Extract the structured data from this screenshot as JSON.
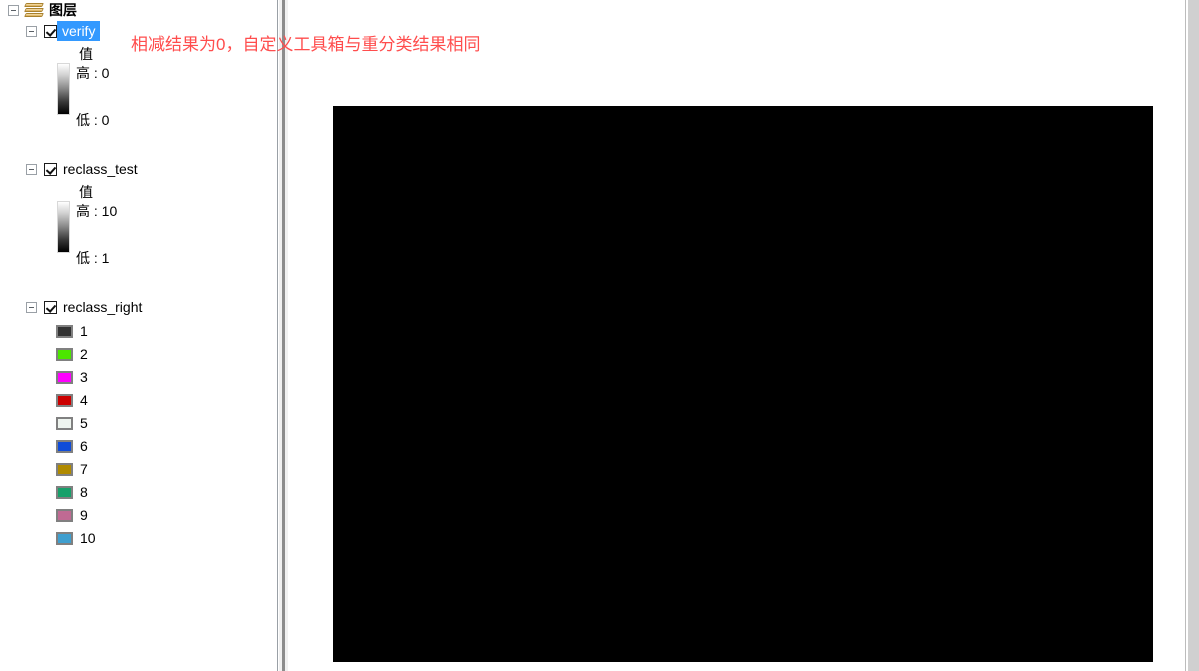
{
  "panel": {
    "root": {
      "label": "图层",
      "icon": "layers-icon",
      "expander": "minus",
      "expanded": true
    },
    "layers": [
      {
        "name": "verify",
        "selected": true,
        "checked": true,
        "symbology": {
          "type": "stretched",
          "heading": "值",
          "high_label": "高 : 0",
          "low_label": "低 : 0",
          "ramp_from": "#ffffff",
          "ramp_to": "#000000"
        }
      },
      {
        "name": "reclass_test",
        "selected": false,
        "checked": true,
        "symbology": {
          "type": "stretched",
          "heading": "值",
          "high_label": "高 : 10",
          "low_label": "低 : 1",
          "ramp_from": "#ffffff",
          "ramp_to": "#000000"
        }
      },
      {
        "name": "reclass_right",
        "selected": false,
        "checked": true,
        "symbology": {
          "type": "unique-values",
          "classes": [
            {
              "label": "1",
              "color": "#333333"
            },
            {
              "label": "2",
              "color": "#4ce600"
            },
            {
              "label": "3",
              "color": "#ff00ff"
            },
            {
              "label": "4",
              "color": "#cc0000"
            },
            {
              "label": "5",
              "color": "#eef4ef"
            },
            {
              "label": "6",
              "color": "#0f4cd9"
            },
            {
              "label": "7",
              "color": "#b08a00"
            },
            {
              "label": "8",
              "color": "#17a06a"
            },
            {
              "label": "9",
              "color": "#c06a93"
            },
            {
              "label": "10",
              "color": "#3f9fcf"
            }
          ]
        }
      }
    ]
  },
  "annotation": {
    "text": "相减结果为0，自定义工具箱与重分类结果相同",
    "color": "#ff4d4d"
  },
  "map": {
    "raster_fill": "#000000"
  }
}
